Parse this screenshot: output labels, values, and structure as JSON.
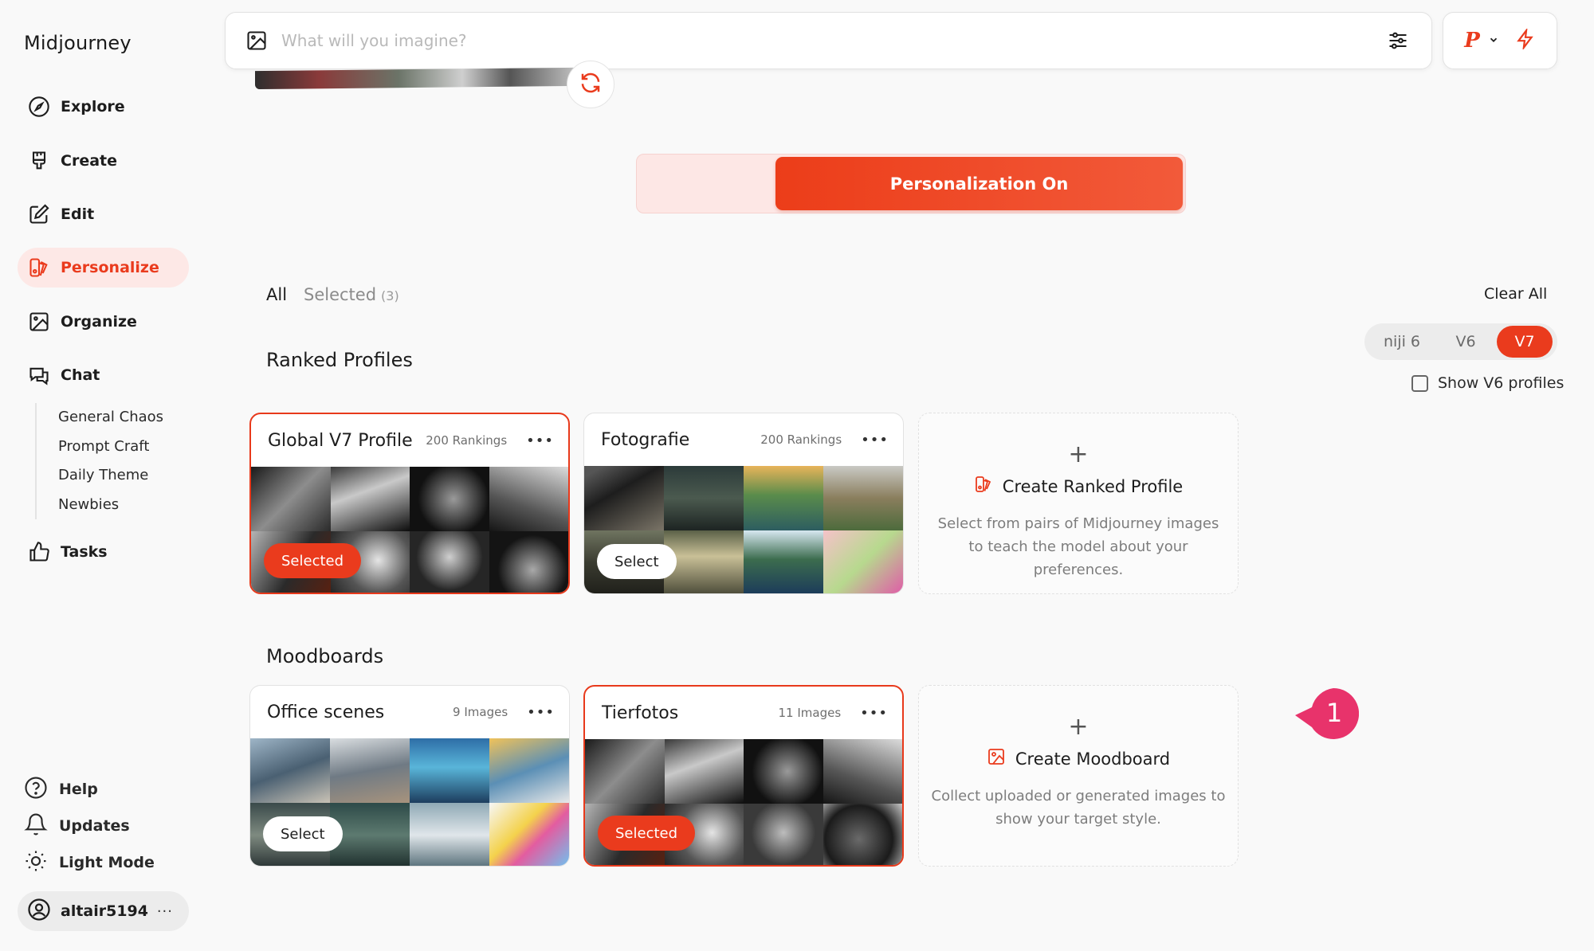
{
  "app": {
    "title": "Midjourney"
  },
  "nav": [
    {
      "label": "Explore",
      "icon": "compass-icon"
    },
    {
      "label": "Create",
      "icon": "brush-icon"
    },
    {
      "label": "Edit",
      "icon": "edit-icon"
    },
    {
      "label": "Personalize",
      "icon": "personalize-icon",
      "active": true
    },
    {
      "label": "Organize",
      "icon": "image-icon"
    },
    {
      "label": "Chat",
      "icon": "chat-icon"
    }
  ],
  "chat_rooms": [
    "General Chaos",
    "Prompt Craft",
    "Daily Theme",
    "Newbies"
  ],
  "tasks": {
    "label": "Tasks",
    "icon": "thumbs-up-icon"
  },
  "footer": {
    "help": "Help",
    "updates": "Updates",
    "light_mode": "Light Mode",
    "username": "altair5194",
    "more": "···"
  },
  "prompt": {
    "placeholder": "What will you imagine?"
  },
  "profile_badge": {
    "letter": "P"
  },
  "personalization": {
    "label": "Personalization On"
  },
  "filters": {
    "all": "All",
    "selected": "Selected",
    "selected_count": "(3)",
    "clear_all": "Clear All",
    "versions": [
      "niji 6",
      "V6",
      "V7"
    ],
    "active_version": "V7",
    "show_v6": "Show V6 profiles"
  },
  "ranked_profiles": {
    "title": "Ranked Profiles",
    "cards": [
      {
        "title": "Global V7 Profile",
        "meta": "200 Rankings",
        "state": "Selected"
      },
      {
        "title": "Fotografie",
        "meta": "200 Rankings",
        "state": "Select"
      }
    ],
    "create": {
      "title": "Create Ranked Profile",
      "desc": "Select from pairs of Midjourney images to teach the model about your preferences."
    }
  },
  "moodboards": {
    "title": "Moodboards",
    "cards": [
      {
        "title": "Office scenes",
        "meta": "9 Images",
        "state": "Select"
      },
      {
        "title": "Tierfotos",
        "meta": "11 Images",
        "state": "Selected"
      }
    ],
    "create": {
      "title": "Create Moodboard",
      "desc": "Collect uploaded or generated images to show your target style."
    }
  },
  "callout": {
    "number": "1"
  },
  "colors": {
    "accent": "#ea3b1d",
    "accent_soft": "#fde8e6",
    "callout": "#e8336b"
  }
}
